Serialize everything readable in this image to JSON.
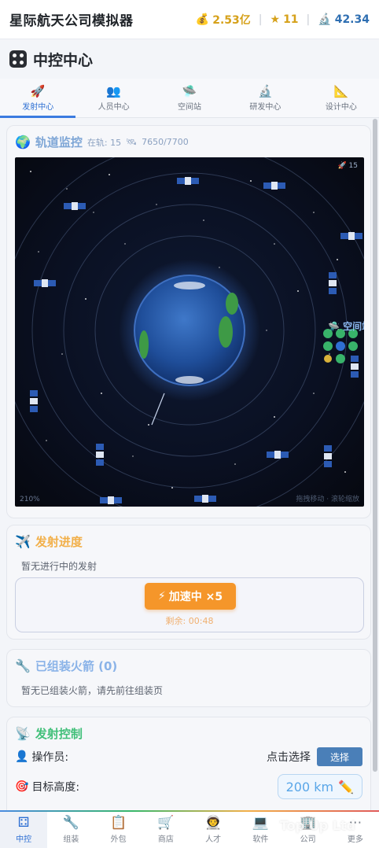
{
  "header": {
    "app_title": "星际航天公司模拟器",
    "money": "2.53亿",
    "stars": "11",
    "science": "42.34"
  },
  "section": {
    "title": "中控中心"
  },
  "tabs": [
    {
      "label": "发射中心",
      "icon": "rocket-icon"
    },
    {
      "label": "人员中心",
      "icon": "people-icon"
    },
    {
      "label": "空间站",
      "icon": "ufo-icon"
    },
    {
      "label": "研发中心",
      "icon": "microscope-icon"
    },
    {
      "label": "设计中心",
      "icon": "triangle-ruler-icon"
    }
  ],
  "orbit": {
    "title": "轨道监控",
    "in_orbit": "在轨: 15",
    "capacity": "7650/7700",
    "count_tag": "15",
    "zoom": "210%",
    "station_label": "空间站",
    "hint": "拖拽移动 · 滚轮缩放"
  },
  "progress": {
    "title": "发射进度",
    "empty_text": "暂无进行中的发射",
    "boost_label": "加速中 ×5",
    "remaining": "剩余: 00:48"
  },
  "assembled": {
    "title": "已组装火箭 (0)",
    "empty_text": "暂无已组装火箭，请先前往组装页"
  },
  "control": {
    "title": "发射控制",
    "operator_label": "操作员:",
    "operator_value": "点击选择",
    "select_button": "选择",
    "altitude_label": "目标高度:",
    "altitude_value": "200 km"
  },
  "bottom_nav": [
    {
      "label": "中控",
      "icon": "dice-icon"
    },
    {
      "label": "组装",
      "icon": "wrench-icon"
    },
    {
      "label": "外包",
      "icon": "clipboard-icon"
    },
    {
      "label": "商店",
      "icon": "cart-icon"
    },
    {
      "label": "人才",
      "icon": "astronaut-icon"
    },
    {
      "label": "软件",
      "icon": "laptop-icon"
    },
    {
      "label": "公司",
      "icon": "building-icon"
    },
    {
      "label": "更多",
      "icon": "more-icon"
    }
  ],
  "watermark": "Top Up Ltd"
}
